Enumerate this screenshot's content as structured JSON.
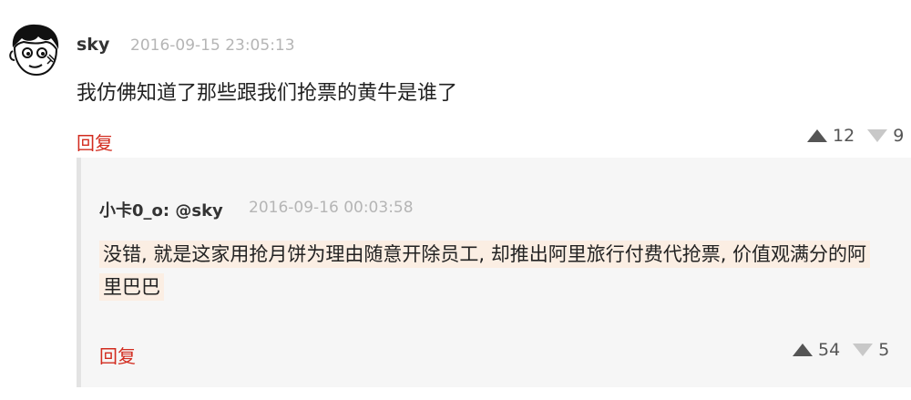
{
  "comment": {
    "username": "sky",
    "timestamp": "2016-09-15 23:05:13",
    "text": "我仿佛知道了那些跟我们抢票的黄牛是谁了",
    "reply_label": "回复",
    "upvotes": "12",
    "downvotes": "9",
    "avatar_icon": "cartoon-face-avatar"
  },
  "reply": {
    "username": "小卡0_o: @sky",
    "timestamp": "2016-09-16 00:03:58",
    "text": "没错, 就是这家用抢月饼为理由随意开除员工, 却推出阿里旅行付费代抢票, 价值观满分的阿里巴巴",
    "reply_label": "回复",
    "upvotes": "54",
    "downvotes": "5"
  },
  "colors": {
    "reply_link": "#d22c1f",
    "timestamp": "#b5b5b5",
    "highlight": "#fbeee3",
    "nested_bg": "#f6f6f6"
  }
}
